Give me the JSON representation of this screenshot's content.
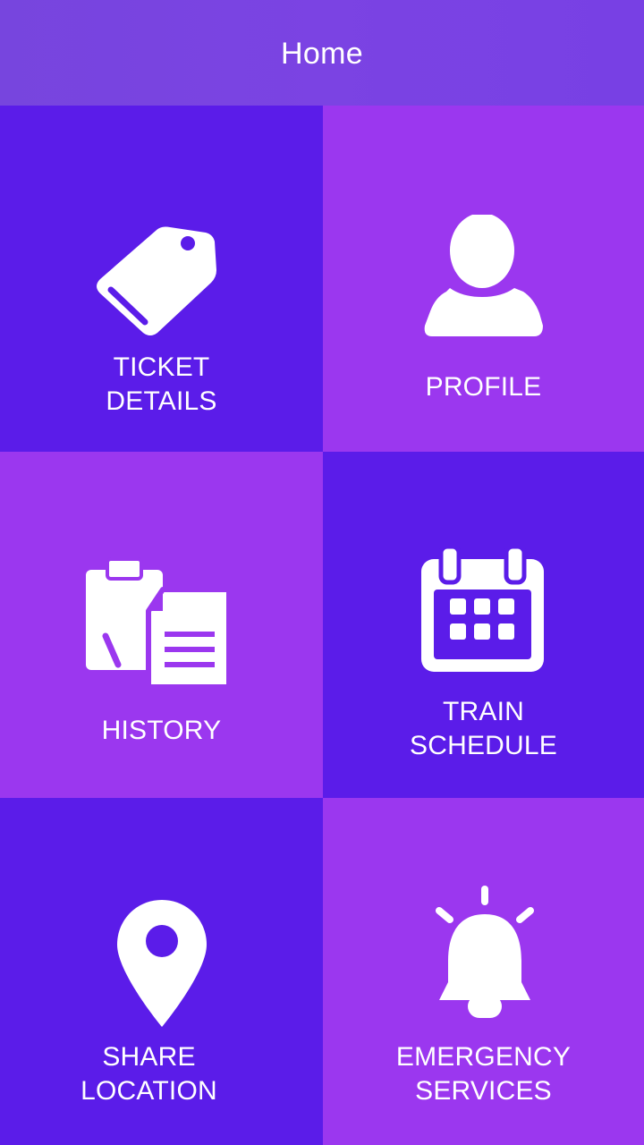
{
  "header": {
    "title": "Home"
  },
  "colors": {
    "header": "#7943e1",
    "tile_dark": "#5b1ce9",
    "tile_light": "#9b37ef",
    "foreground": "#ffffff"
  },
  "tiles": [
    {
      "label": "TICKET\nDETAILS",
      "icon": "ticket-tag-icon",
      "color": "#5b1ce9"
    },
    {
      "label": "PROFILE",
      "icon": "user-profile-icon",
      "color": "#9b37ef"
    },
    {
      "label": "HISTORY",
      "icon": "clipboard-documents-icon",
      "color": "#9b37ef"
    },
    {
      "label": "TRAIN\nSCHEDULE",
      "icon": "calendar-icon",
      "color": "#5b1ce9"
    },
    {
      "label": "SHARE\nLOCATION",
      "icon": "map-pin-icon",
      "color": "#5b1ce9"
    },
    {
      "label": "EMERGENCY\nSERVICES",
      "icon": "alarm-bell-icon",
      "color": "#9b37ef"
    }
  ]
}
